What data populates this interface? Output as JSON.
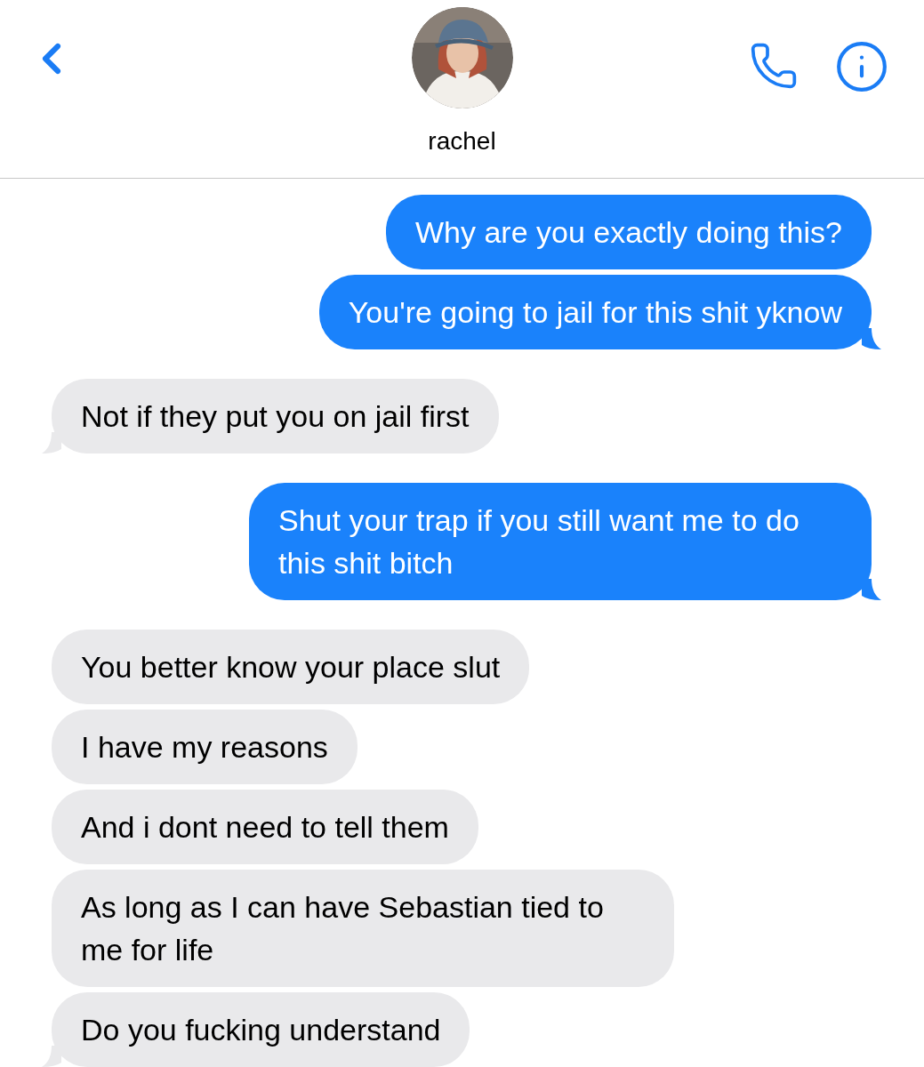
{
  "header": {
    "back": {
      "kind": "back"
    },
    "name": "rachel"
  },
  "messages": [
    {
      "kind": "sent",
      "text": "Why are you exactly doing this?",
      "tail": false
    },
    {
      "kind": "sent",
      "text": "You're going to jail for this shit yknow",
      "tail": true
    },
    {
      "kind": "received",
      "text": "Not if they put you on jail first",
      "tail": true
    },
    {
      "kind": "sent",
      "text": "Shut your trap if you still want me to do this shit bitch",
      "tail": true
    },
    {
      "kind": "received",
      "text": "You better know your place slut",
      "tail": false
    },
    {
      "kind": "received",
      "text": "I have my reasons",
      "tail": false
    },
    {
      "kind": "received",
      "text": "And i dont need to tell them",
      "tail": false
    },
    {
      "kind": "received",
      "text": "As long as I can have Sebastian tied to me for life",
      "tail": false
    },
    {
      "kind": "received",
      "text": "Do you fucking understand",
      "tail": true
    }
  ]
}
